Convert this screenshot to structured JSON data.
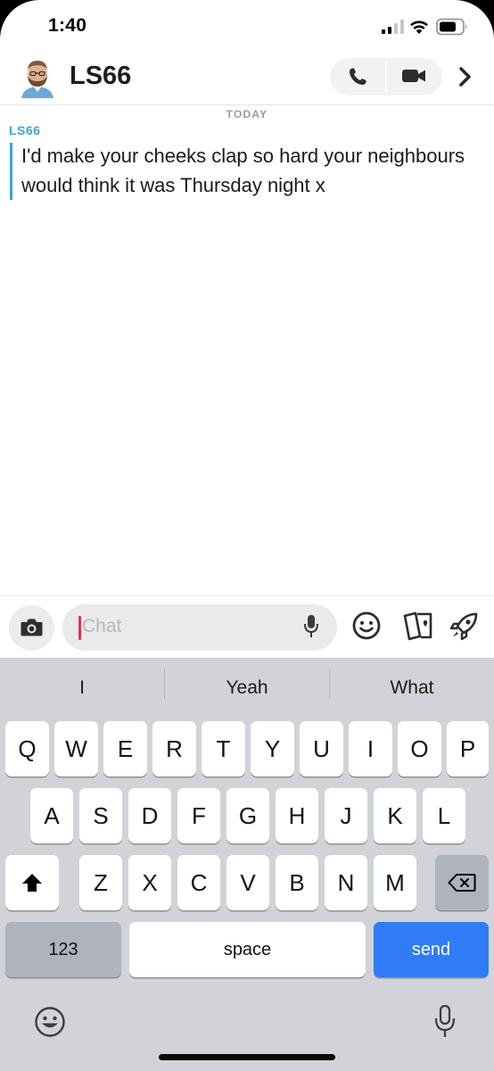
{
  "status_bar": {
    "time": "1:40"
  },
  "header": {
    "name": "LS66"
  },
  "chat": {
    "date_divider": "TODAY",
    "messages": [
      {
        "sender": "LS66",
        "text": "I'd make your cheeks clap so hard your neighbours would think it was Thursday night x"
      }
    ]
  },
  "composer": {
    "placeholder": "Chat"
  },
  "keyboard": {
    "suggestions": [
      "I",
      "Yeah",
      "What"
    ],
    "row1": [
      "Q",
      "W",
      "E",
      "R",
      "T",
      "Y",
      "U",
      "I",
      "O",
      "P"
    ],
    "row2": [
      "A",
      "S",
      "D",
      "F",
      "G",
      "H",
      "J",
      "K",
      "L"
    ],
    "row3": [
      "Z",
      "X",
      "C",
      "V",
      "B",
      "N",
      "M"
    ],
    "numbers_label": "123",
    "space_label": "space",
    "send_label": "send"
  },
  "colors": {
    "accent_blue": "#3ea3df",
    "send_blue": "#2f7cf6",
    "caret_red": "#e8334f"
  },
  "icons": [
    "camera-icon",
    "microphone-icon",
    "smile-icon",
    "cards-icon",
    "rocket-icon",
    "phone-icon",
    "video-icon",
    "chevron-right-icon",
    "shift-icon",
    "delete-icon",
    "emoji-icon"
  ]
}
